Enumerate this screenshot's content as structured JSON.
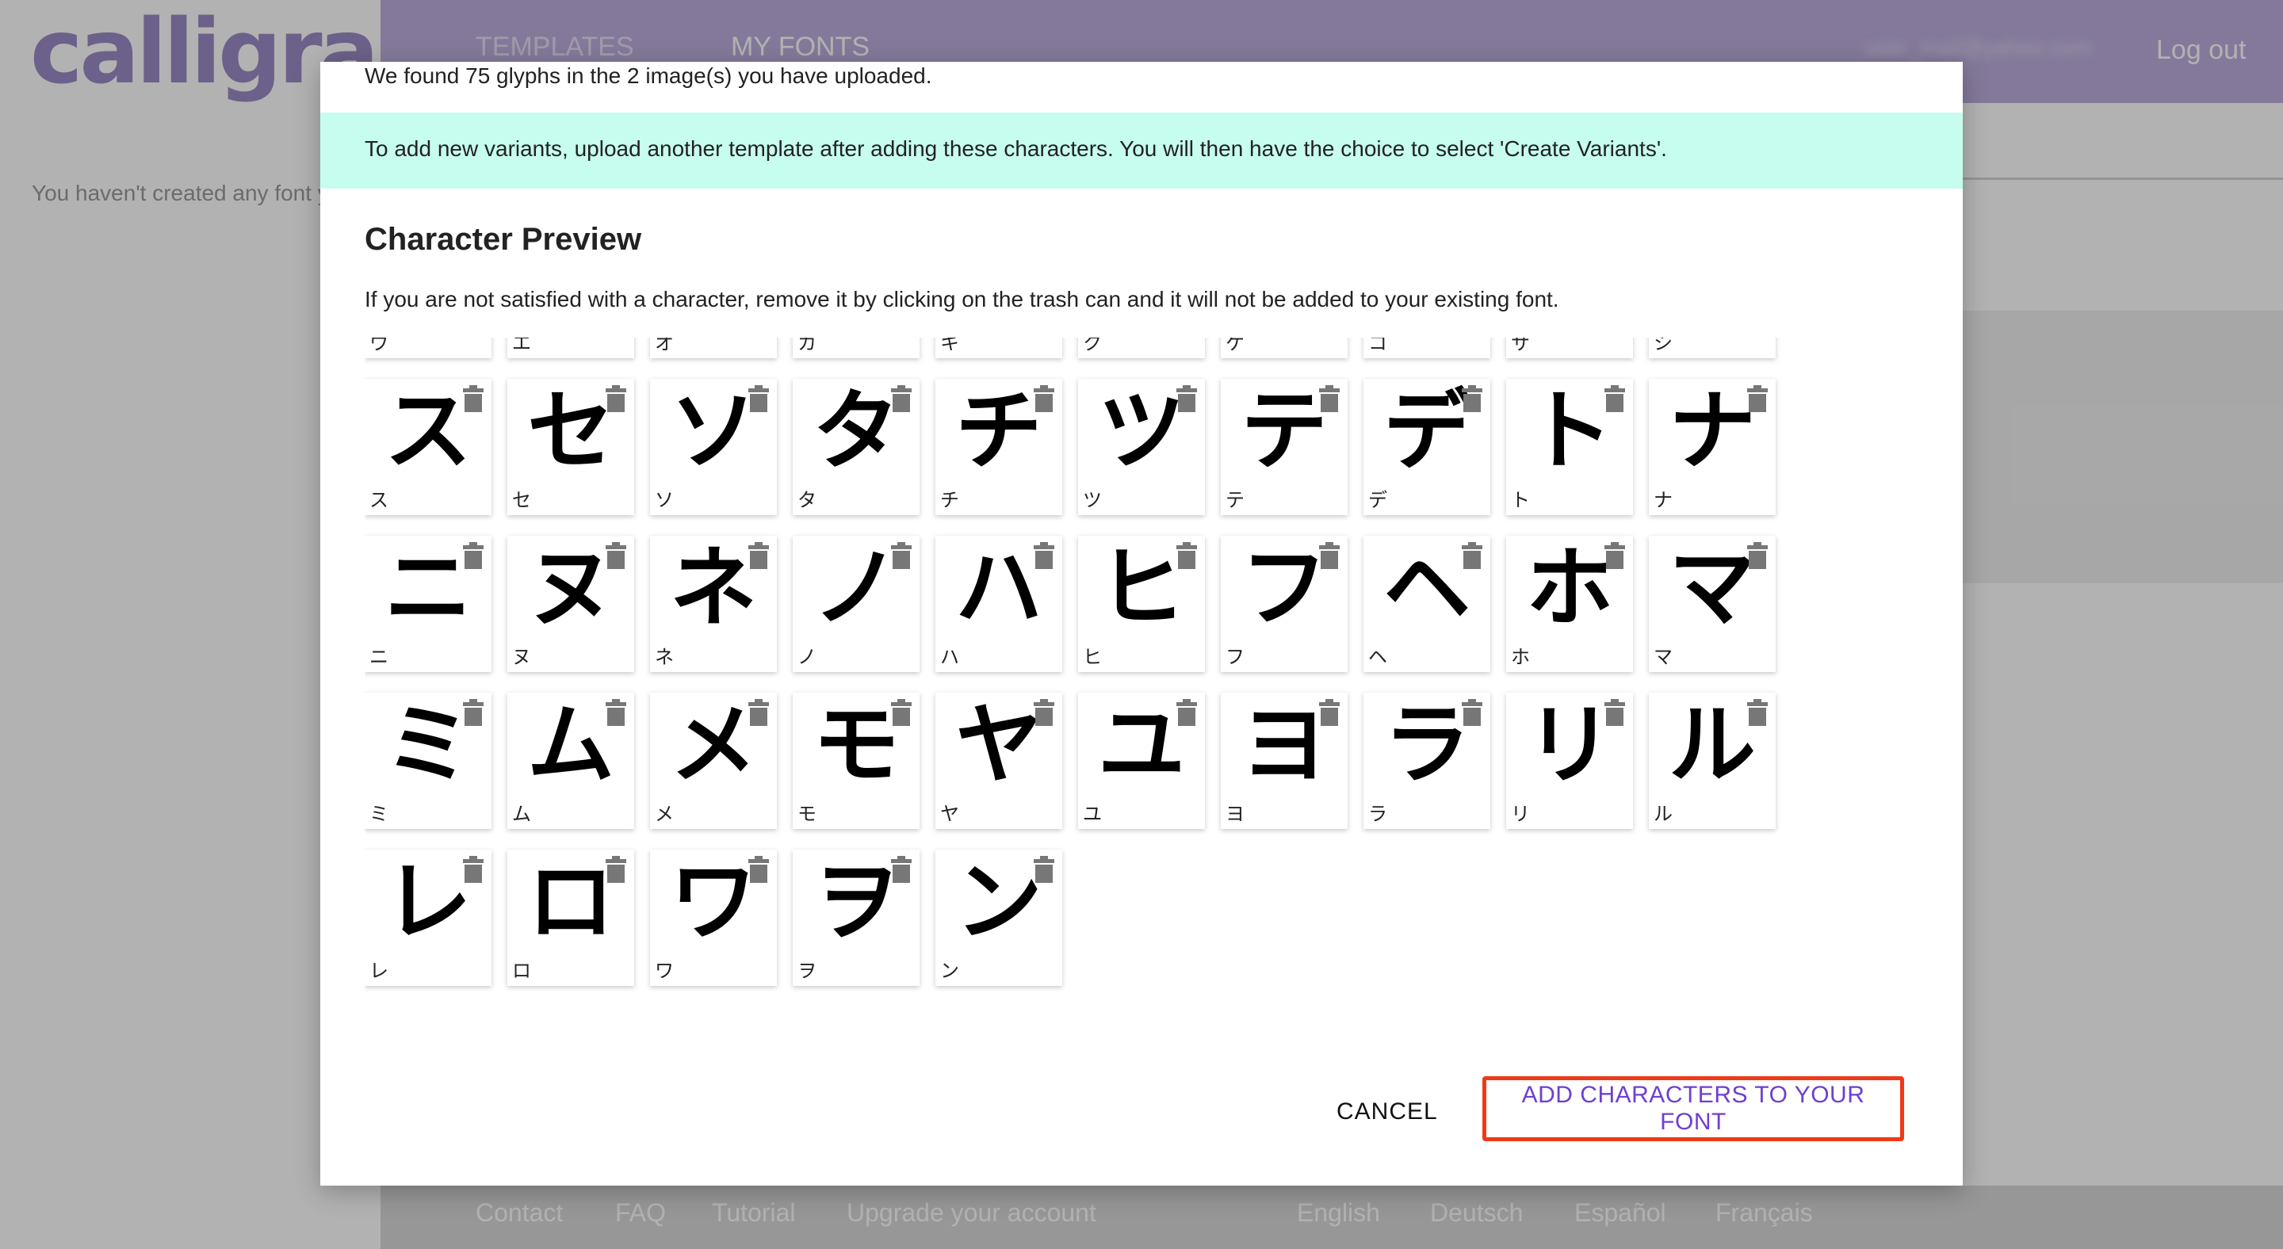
{
  "app": {
    "logo": "calligraphr",
    "nav": {
      "templates": "TEMPLATES",
      "my_fonts": "MY FONTS"
    },
    "user_email": "user_mail@yahoo.com",
    "logout": "Log out",
    "empty_message": "You haven't created any font y"
  },
  "footer": {
    "links": [
      "Contact",
      "FAQ",
      "Tutorial",
      "Upgrade your account"
    ],
    "languages": [
      "English",
      "Deutsch",
      "Español",
      "Français"
    ]
  },
  "dialog": {
    "found_text": "We found 75 glyphs in the 2 image(s) you have uploaded.",
    "info_text": "To add new variants, upload another template after adding these characters. You will then have the choice to select 'Create Variants'.",
    "preview_title": "Character Preview",
    "instructions": "If you are not satisfied with a character, remove it by clicking on the trash can and it will not be added to your existing font.",
    "glyph_rows": [
      [
        "ウ",
        "エ",
        "オ",
        "カ",
        "キ",
        "ク",
        "ケ",
        "コ",
        "サ",
        "シ"
      ],
      [
        "ス",
        "セ",
        "ソ",
        "タ",
        "チ",
        "ツ",
        "テ",
        "デ",
        "ト",
        "ナ"
      ],
      [
        "ニ",
        "ヌ",
        "ネ",
        "ノ",
        "ハ",
        "ヒ",
        "フ",
        "ヘ",
        "ホ",
        "マ"
      ],
      [
        "ミ",
        "ム",
        "メ",
        "モ",
        "ヤ",
        "ユ",
        "ヨ",
        "ラ",
        "リ",
        "ル"
      ],
      [
        "レ",
        "ロ",
        "ワ",
        "ヲ",
        "ン"
      ]
    ],
    "cancel_label": "CANCEL",
    "add_label": "ADD CHARACTERS TO YOUR FONT"
  },
  "colors": {
    "header_purple": "#9b8cc6",
    "banner_mint": "#c7fdef",
    "action_purple": "#6d3fd4",
    "highlight_red": "#ef3a17"
  }
}
